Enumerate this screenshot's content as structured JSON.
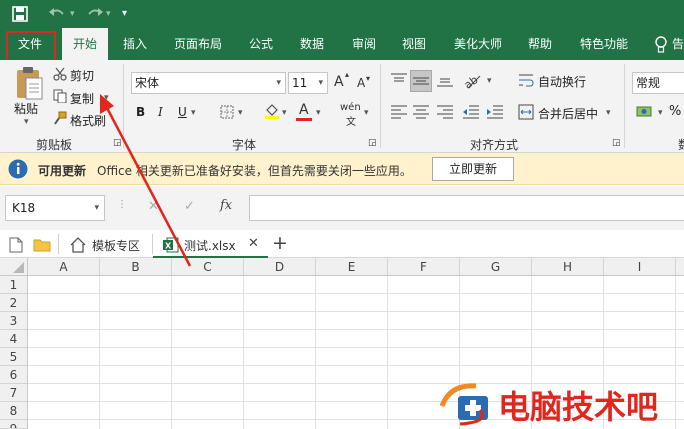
{
  "quick_access": {
    "save_icon": "save-icon",
    "undo_icon": "undo-icon",
    "redo_icon": "redo-icon",
    "more": "▾"
  },
  "tabs": [
    {
      "label": "文件",
      "active": false
    },
    {
      "label": "开始",
      "active": true
    },
    {
      "label": "插入",
      "active": false
    },
    {
      "label": "页面布局",
      "active": false
    },
    {
      "label": "公式",
      "active": false
    },
    {
      "label": "数据",
      "active": false
    },
    {
      "label": "审阅",
      "active": false
    },
    {
      "label": "视图",
      "active": false
    },
    {
      "label": "美化大师",
      "active": false
    },
    {
      "label": "帮助",
      "active": false
    },
    {
      "label": "特色功能",
      "active": false
    }
  ],
  "clipboard": {
    "paste": "粘贴",
    "cut": "剪切",
    "copy": "复制",
    "format_painter": "格式刷",
    "group": "剪贴板"
  },
  "font": {
    "name": "宋体",
    "size": "11",
    "bold": "B",
    "italic": "I",
    "underline": "U",
    "grow": "A",
    "shrink": "A",
    "wen": "wén",
    "group": "字体",
    "font_color": "#e0261d",
    "highlight_color": "#ffff00"
  },
  "alignment": {
    "wrap": "自动换行",
    "merge": "合并后居中",
    "group": "对齐方式"
  },
  "number": {
    "format": "常规",
    "percent": "%",
    "group": "数"
  },
  "infobar": {
    "title": "可用更新",
    "message": "Office 相关更新已准备好安装，但首先需要关闭一些应用。",
    "button": "立即更新"
  },
  "formula_bar": {
    "name_box": "K18",
    "fx": "fx",
    "cancel": "✕",
    "confirm": "✓"
  },
  "sheet_tabs": {
    "template": "模板专区",
    "file": "测试.xlsx",
    "close": "✕",
    "add": "+"
  },
  "columns": [
    "A",
    "B",
    "C",
    "D",
    "E",
    "F",
    "G",
    "H",
    "I"
  ],
  "rows": [
    "1",
    "2",
    "3",
    "4",
    "5",
    "6",
    "7",
    "8",
    "9"
  ],
  "watermark": {
    "text": "电脑技术吧"
  }
}
